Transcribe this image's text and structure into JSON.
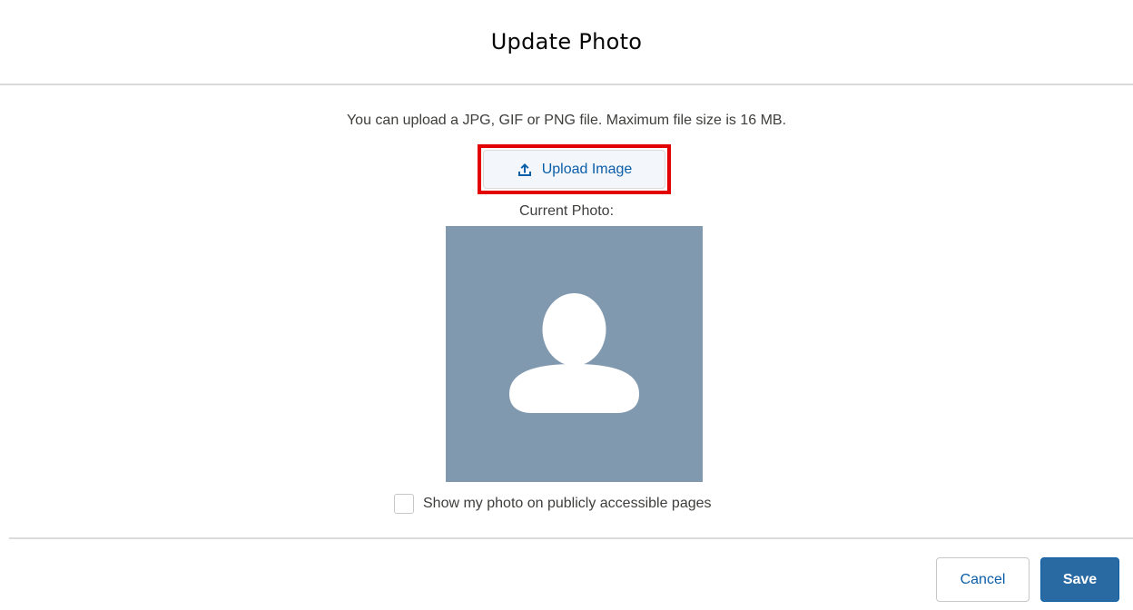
{
  "modal": {
    "title": "Update Photo",
    "instructions": "You can upload a JPG, GIF or PNG file. Maximum file size is 16 MB.",
    "upload_button": {
      "label": "Upload Image",
      "icon": "upload-icon",
      "highlighted": true
    },
    "current_photo_label": "Current Photo:",
    "photo": {
      "type": "default-avatar-placeholder",
      "icon": "person-silhouette-icon"
    },
    "public_checkbox": {
      "label": "Show my photo on publicly accessible pages",
      "checked": false
    },
    "footer": {
      "cancel_label": "Cancel",
      "save_label": "Save"
    }
  },
  "colors": {
    "accent": "#0b5ea8",
    "save_button_bg": "#2a6aa3",
    "avatar_bg": "#8199af",
    "highlight_box": "#e30000",
    "divider": "#dddbda"
  }
}
